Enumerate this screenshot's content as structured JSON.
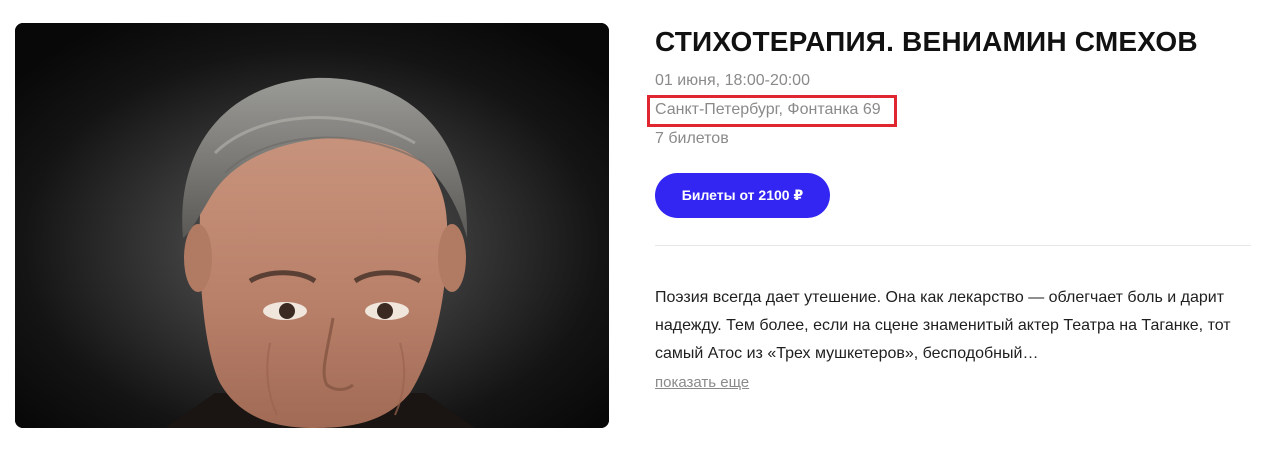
{
  "event": {
    "title": "СТИХОТЕРАПИЯ. ВЕНИАМИН СМЕХОВ",
    "date": "01 июня, 18:00-20:00",
    "venue": "Санкт-Петербург, Фонтанка 69",
    "tickets_count": "7 билетов",
    "buy_button_label": "Билеты от 2100 ₽",
    "description": "Поэзия всегда дает утешение. Она как лекарство — облегчает боль и дарит надежду. Тем более, если на сцене знаменитый актер Театра на Таганке, тот самый Атос из «Трех мушкетеров», бесподобный…",
    "show_more_label": "показать еще"
  },
  "colors": {
    "accent": "#3326f2",
    "highlight_box": "#e0262f",
    "muted_text": "#8a8a8a"
  },
  "icons": {
    "photo": "portrait-photo"
  }
}
